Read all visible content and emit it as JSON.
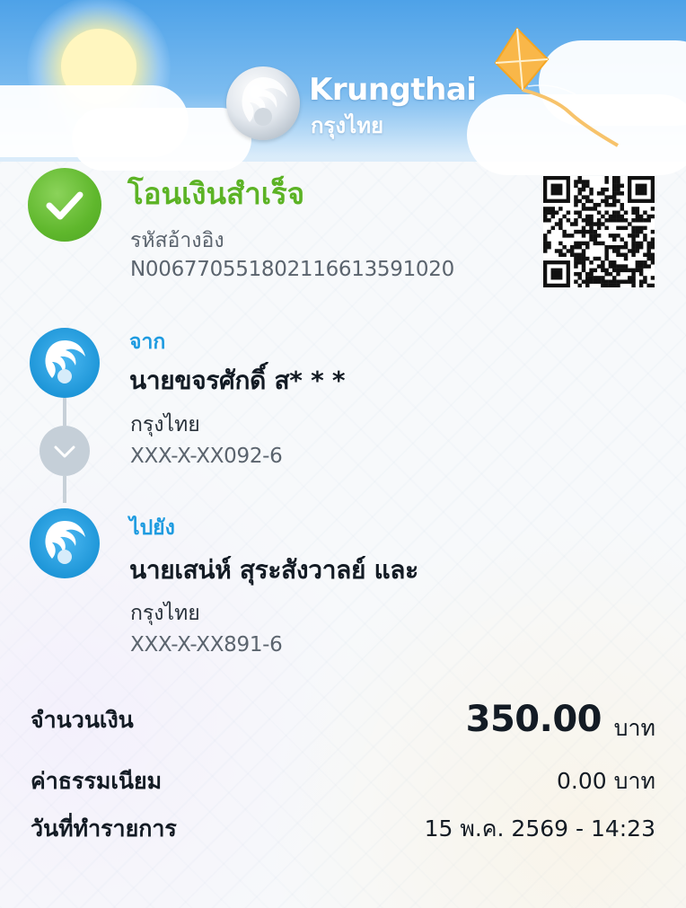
{
  "logo": {
    "name_en": "Krungthai",
    "name_th": "กรุงไทย"
  },
  "status": {
    "title": "โอนเงินสำเร็จ",
    "ref_label": "รหัสอ้างอิง",
    "ref_value": "N006770551802116613591020",
    "color": "#5cb325"
  },
  "from": {
    "label": "จาก",
    "name": "นายขจรศักดิ์ ส* * *",
    "bank": "กรุงไทย",
    "account": "XXX-X-XX092-6"
  },
  "to": {
    "label": "ไปยัง",
    "name": "นายเสน่ห์ สุระสังวาลย์ และ",
    "bank": "กรุงไทย",
    "account": "XXX-X-XX891-6"
  },
  "amount": {
    "label": "จำนวนเงิน",
    "value": "350.00",
    "unit": "บาท"
  },
  "fee": {
    "label": "ค่าธรรมเนียม",
    "value": "0.00 บาท"
  },
  "date": {
    "label": "วันที่ทำรายการ",
    "value": "15 พ.ค. 2569 - 14:23"
  },
  "colors": {
    "accent_blue": "#1e9be0",
    "success_green": "#5cb325",
    "text_dark": "#131b24",
    "text_muted": "#5b646e"
  },
  "icons": [
    "krungthai-logo-icon",
    "check-icon",
    "qr-code-icon",
    "bank-avatar-icon",
    "chevron-down-icon",
    "kite-icon",
    "sun-icon"
  ]
}
